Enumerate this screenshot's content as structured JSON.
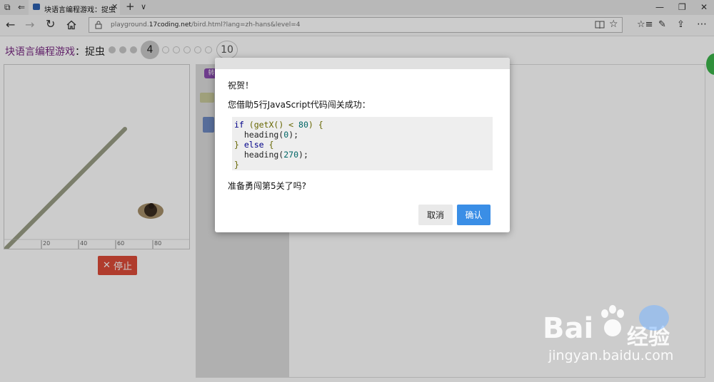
{
  "browser": {
    "tab_title": "块语言编程游戏：捉虫",
    "new_tab_glyph": "+",
    "tab_menu_glyph": "∨",
    "url_prefix": "playground.",
    "url_domain": "17coding.net",
    "url_suffix": "/bird.html?lang=zh-hans&level=4",
    "window_controls": [
      "—",
      "❐",
      "✕"
    ]
  },
  "page": {
    "title_main": "块语言编程游戏",
    "title_sep": "：",
    "title_level": "捉虫",
    "current_level": "4",
    "last_level": "10",
    "stop_label": "停止",
    "axis_ticks": [
      "20",
      "40",
      "60",
      "80"
    ],
    "toolbox_badge": "转"
  },
  "dialog": {
    "heading": "祝贺！",
    "message": "您借助5行JavaScript代码闯关成功：",
    "code": {
      "line1": {
        "kw": "if",
        "p1": " (getX() < ",
        "n": "80",
        "p2": ") {"
      },
      "line2": {
        "p1": "  heading(",
        "n": "0",
        "p2": ");"
      },
      "line3": {
        "p1": "} ",
        "kw": "else",
        "p2": " {"
      },
      "line4": {
        "p1": "  heading(",
        "n": "270",
        "p2": ");"
      },
      "line5": {
        "p1": "}"
      }
    },
    "prompt": "准备勇闯第5关了吗?",
    "cancel_label": "取消",
    "ok_label": "确认"
  },
  "watermark": {
    "brand": "Bai",
    "brand2": "经验",
    "url": "jingyan.baidu.com"
  },
  "colors": {
    "title": "#7a2b84",
    "stop": "#dd4b39",
    "ok": "#3a8ee6"
  },
  "icons": [
    "tab-list-icon",
    "tab-back-icon",
    "app-icon",
    "close-icon",
    "back-arrow-icon",
    "forward-arrow-icon",
    "refresh-icon",
    "home-icon",
    "lock-icon",
    "reading-view-icon",
    "star-icon",
    "favorites-icon",
    "pen-icon",
    "share-icon",
    "more-icon"
  ]
}
